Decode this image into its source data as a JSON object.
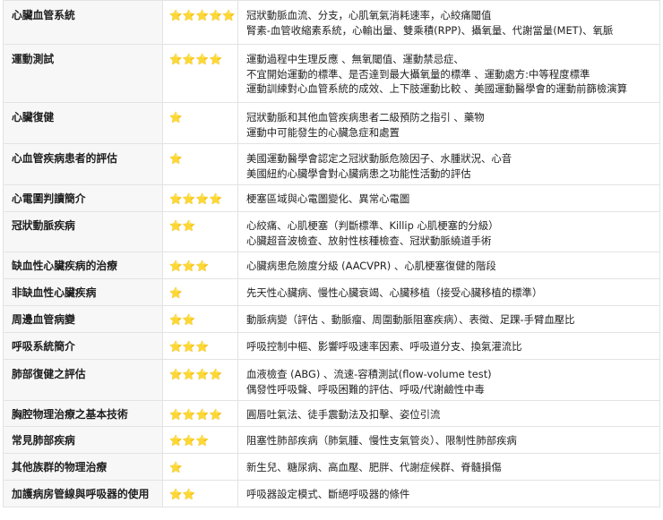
{
  "rows": [
    {
      "topic": "心臟血管系統",
      "stars": "⭐⭐⭐⭐⭐",
      "lines": [
        "冠狀動脈血流、分支，心肌氧氣消耗速率，心絞痛閾值",
        "腎素-血管收縮素系統，心輸出量、雙乘積(RPP)、攝氧量、代謝當量(MET)、氧脈"
      ]
    },
    {
      "topic": "運動測試",
      "stars": "⭐⭐⭐⭐",
      "lines": [
        "運動過程中生理反應 、無氧閾值、運動禁忌症、",
        "不宜開始運動的標準、是否達到最大攝氧量的標準 、運動處方:中等程度標準",
        "運動訓練對心血管系統的成效、上下肢運動比較 、美國運動醫學會的運動前篩檢演算"
      ]
    },
    {
      "topic": "心臟復健",
      "stars": "⭐",
      "lines": [
        "冠狀動脈和其他血管疾病患者二級預防之指引 、藥物",
        "運動中可能發生的心臟急症和處置"
      ]
    },
    {
      "topic": "心血管疾病患者的評估",
      "stars": "⭐",
      "lines": [
        "美國運動醫學會認定之冠狀動脈危險因子、水腫狀況、心音",
        "美國紐約心臟學會對心臟病患之功能性活動的評估"
      ]
    },
    {
      "topic": "心電圖判讀簡介",
      "stars": "⭐⭐⭐⭐",
      "lines": [
        "梗塞區域與心電圖變化、異常心電圖"
      ]
    },
    {
      "topic": "冠狀動脈疾病",
      "stars": "⭐⭐",
      "lines": [
        "心絞痛、心肌梗塞（判斷標準、Killip 心肌梗塞的分級）",
        "心臟超音波檢查、放射性核種檢查、冠狀動脈繞道手術"
      ]
    },
    {
      "topic": "缺血性心臟疾病的治療",
      "stars": "⭐⭐⭐",
      "lines": [
        "心臟病患危險度分級 (AACVPR) 、心肌梗塞復健的階段"
      ]
    },
    {
      "topic": "非缺血性心臟疾病",
      "stars": "⭐",
      "lines": [
        "先天性心臟病、慢性心臟衰竭、心臟移植（接受心臟移植的標準）"
      ]
    },
    {
      "topic": "周邊血管病變",
      "stars": "⭐⭐",
      "lines": [
        "動脈病變（評估 、動脈瘤、周圍動脈阻塞疾病）、表徵、足踝-手臂血壓比"
      ]
    },
    {
      "topic": "呼吸系統簡介",
      "stars": "⭐⭐⭐",
      "lines": [
        "呼吸控制中樞、影響呼吸速率因素、呼吸道分支、換氣灌流比"
      ]
    },
    {
      "topic": "肺部復健之評估",
      "stars": "⭐⭐⭐⭐",
      "lines": [
        "血液檢查 (ABG) 、流速-容積測試(flow-volume test)",
        "偶發性呼吸聲、呼吸困難的評估、呼吸/代謝鹼性中毒"
      ]
    },
    {
      "topic": "胸腔物理治療之基本技術",
      "stars": "⭐⭐⭐⭐",
      "lines": [
        "圓唇吐氣法、徒手震動法及扣擊、姿位引流"
      ]
    },
    {
      "topic": "常見肺部疾病",
      "stars": "⭐⭐⭐",
      "lines": [
        "阻塞性肺部疾病（肺氣腫、慢性支氣管炎）、限制性肺部疾病"
      ]
    },
    {
      "topic": "其他族群的物理治療",
      "stars": "⭐",
      "lines": [
        "新生兒、糖尿病、高血壓、肥胖、代謝症候群、脊髓損傷"
      ]
    },
    {
      "topic": "加護病房管線與呼吸器的使用",
      "stars": "⭐⭐",
      "lines": [
        "呼吸器設定模式、斷絕呼吸器的條件"
      ]
    }
  ]
}
